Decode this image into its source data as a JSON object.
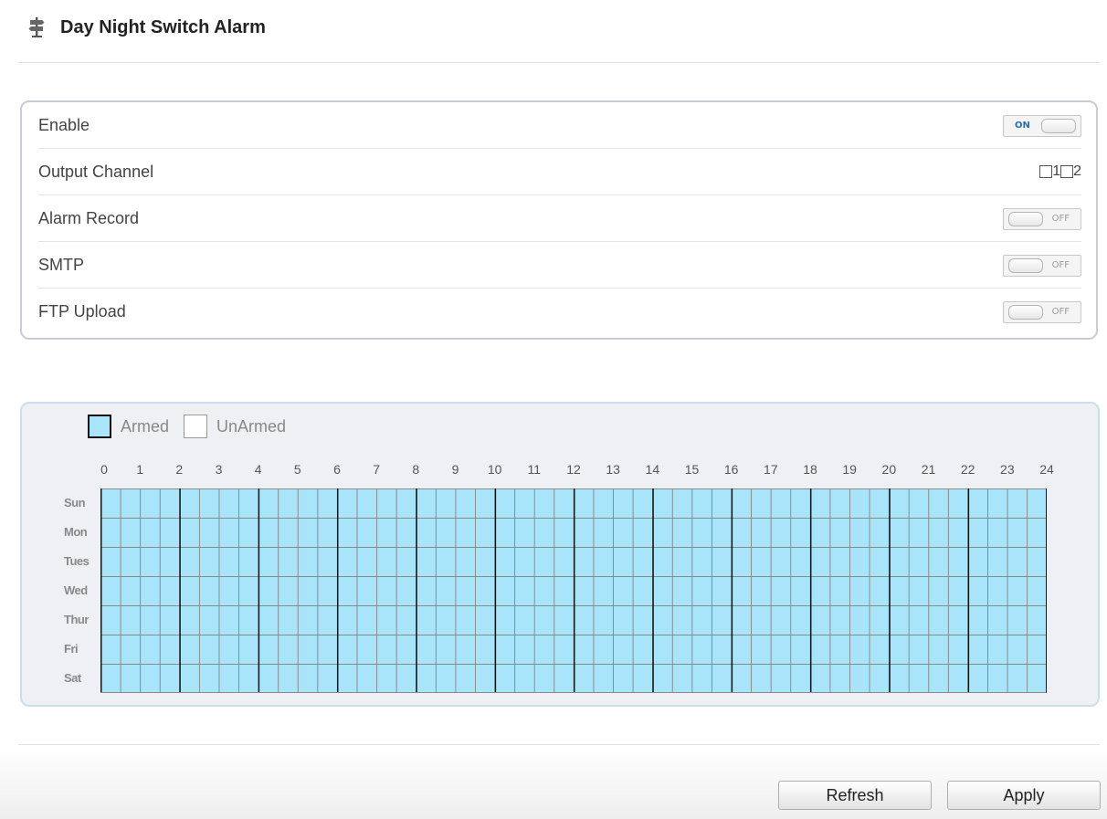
{
  "header": {
    "title": "Day Night Switch Alarm",
    "icon": "signpost-icon"
  },
  "settings": [
    {
      "label": "Enable",
      "control": "toggle",
      "state": "ON"
    },
    {
      "label": "Output Channel",
      "control": "checkboxes",
      "options": [
        {
          "label": "1",
          "checked": false
        },
        {
          "label": "2",
          "checked": false
        }
      ]
    },
    {
      "label": "Alarm Record",
      "control": "toggle",
      "state": "OFF"
    },
    {
      "label": "SMTP",
      "control": "toggle",
      "state": "OFF"
    },
    {
      "label": "FTP Upload",
      "control": "toggle",
      "state": "OFF"
    }
  ],
  "schedule": {
    "legend": {
      "armed": "Armed",
      "unarmed": "UnArmed"
    },
    "hours": [
      "0",
      "1",
      "2",
      "3",
      "4",
      "5",
      "6",
      "7",
      "8",
      "9",
      "10",
      "11",
      "12",
      "13",
      "14",
      "15",
      "16",
      "17",
      "18",
      "19",
      "20",
      "21",
      "22",
      "23",
      "24"
    ],
    "days": [
      "Sun",
      "Mon",
      "Tues",
      "Wed",
      "Thur",
      "Fri",
      "Sat"
    ],
    "slots_per_hour": 2,
    "all_armed": true,
    "colors": {
      "armed": "#a8e5fb",
      "unarmed": "#ffffff"
    }
  },
  "buttons": {
    "refresh": "Refresh",
    "apply": "Apply"
  }
}
